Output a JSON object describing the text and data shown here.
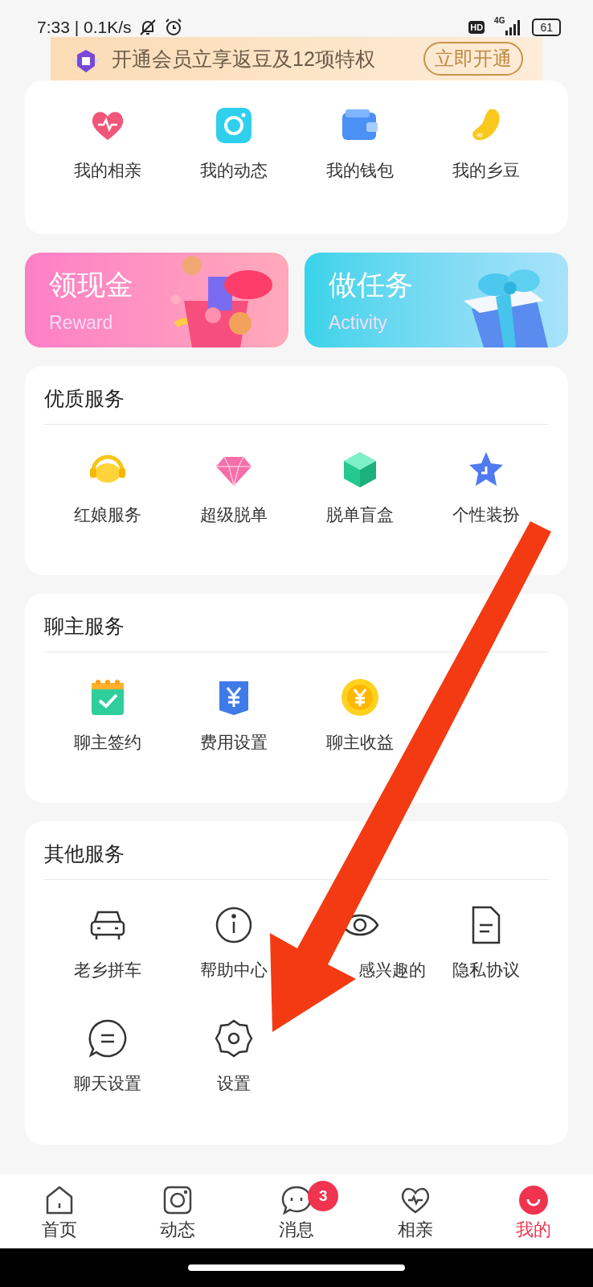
{
  "status_bar": {
    "time": "7:33 | 0.1K/s",
    "hd": "HD",
    "network": "4G",
    "battery": "61"
  },
  "banner": {
    "text": "开通会员立享返豆及12项特权",
    "button": "立即开通"
  },
  "quick_links": [
    {
      "label": "我的相亲"
    },
    {
      "label": "我的动态"
    },
    {
      "label": "我的钱包"
    },
    {
      "label": "我的乡豆"
    }
  ],
  "promos": [
    {
      "title": "领现金",
      "subtitle": "Reward"
    },
    {
      "title": "做任务",
      "subtitle": "Activity"
    }
  ],
  "sections": [
    {
      "title": "优质服务",
      "items": [
        {
          "label": "红娘服务"
        },
        {
          "label": "超级脱单"
        },
        {
          "label": "脱单盲盒"
        },
        {
          "label": "个性装扮"
        }
      ]
    },
    {
      "title": "聊主服务",
      "items": [
        {
          "label": "聊主签约"
        },
        {
          "label": "费用设置"
        },
        {
          "label": "聊主收益"
        }
      ]
    },
    {
      "title": "其他服务",
      "items": [
        {
          "label": "老乡拼车"
        },
        {
          "label": "帮助中心"
        },
        {
          "label": "感兴趣的"
        },
        {
          "label": "隐私协议"
        },
        {
          "label": "聊天设置"
        },
        {
          "label": "设置"
        }
      ]
    }
  ],
  "bottom_nav": [
    {
      "label": "首页",
      "selected": false
    },
    {
      "label": "动态",
      "selected": false
    },
    {
      "label": "消息",
      "selected": false,
      "badge": "3"
    },
    {
      "label": "相亲",
      "selected": false
    },
    {
      "label": "我的",
      "selected": true
    }
  ]
}
